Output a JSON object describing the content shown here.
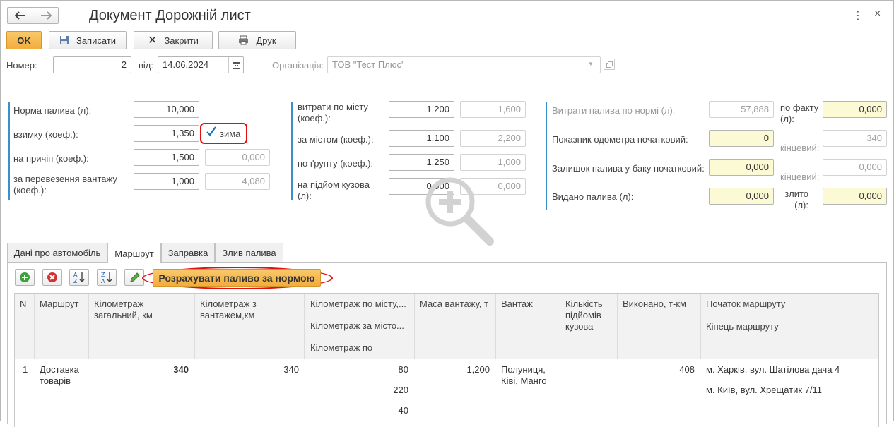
{
  "window": {
    "title": "Документ Дорожній лист"
  },
  "toolbar": {
    "ok": "OK",
    "save": "Записати",
    "close": "Закрити",
    "print": "Друк"
  },
  "header": {
    "number_label": "Номер:",
    "number": "2",
    "date_label": "від:",
    "date": "14.06.2024",
    "org_label": "Організація:",
    "org": "ТОВ \"Тест Плюс\""
  },
  "col1": {
    "norm_label": "Норма палива (л):",
    "norm": "10,000",
    "winter_label": "взимку (коеф.):",
    "winter": "1,350",
    "winter_check_label": "зима",
    "trailer_label": "на причіп (коеф.):",
    "trailer": "1,500",
    "trailer_calc": "0,000",
    "cargo_label": "за перевезення вантажу (коеф.):",
    "cargo": "1,000",
    "cargo_calc": "4,080"
  },
  "col2": {
    "city_label": "витрати по місту (коеф.):",
    "city": "1,200",
    "city_calc": "1,600",
    "outcity_label": "за містом (коеф.):",
    "outcity": "1,100",
    "outcity_calc": "2,200",
    "ground_label": "по ґрунту (коеф.):",
    "ground": "1,250",
    "ground_calc": "1,000",
    "lift_label": "на підйом кузова (л):",
    "lift": "0,000",
    "lift_calc": "0,000"
  },
  "col3": {
    "norm_consumption_label": "Витрати палива по нормі (л):",
    "norm_consumption": "57,888",
    "fact_label": "по факту (л):",
    "fact": "0,000",
    "odo_start_label": "Показник одометра початковий:",
    "odo_start": "0",
    "odo_end_label": "кінцевий:",
    "odo_end": "340",
    "tank_start_label": "Залишок палива у баку початковий:",
    "tank_start": "0,000",
    "tank_end_label": "кінцевий:",
    "tank_end": "0,000",
    "issued_label": "Видано палива (л):",
    "issued": "0,000",
    "drained_label": "злито (л):",
    "drained": "0,000"
  },
  "tabs": [
    "Дані про автомобіль",
    "Маршрут",
    "Заправка",
    "Злив палива"
  ],
  "route_toolbar": {
    "calc_button": "Розрахувати паливо за нормою"
  },
  "table": {
    "headers": {
      "n": "N",
      "route": "Маршрут",
      "km_total": "Кілометраж загальний, км",
      "km_cargo": "Кілометраж з вантажем,км",
      "km_city": "Кілометраж по місту,...",
      "km_outcity": "Кілометраж за місто...",
      "km_ground": "Кілометраж по",
      "mass": "Маса вантажу, т",
      "cargo": "Вантаж",
      "lifts": "Кількість підйомів кузова",
      "done": "Виконано, т-км",
      "start": "Початок маршруту",
      "end": "Кінець маршруту"
    },
    "rows": [
      {
        "n": "1",
        "route": "Доставка товарів",
        "km_total": "340",
        "km_cargo": "340",
        "km_city": "80",
        "km_outcity": "220",
        "km_ground": "40",
        "mass": "1,200",
        "cargo": "Полуниця, Ківі, Манго",
        "lifts": "",
        "done": "408",
        "start": "м. Харків, вул. Шатілова дача 4",
        "end": "м. Київ, вул. Хрещатик 7/11"
      }
    ]
  },
  "colors": {
    "accent": "#3d8fc8",
    "highlight": "#e01010",
    "ok_button": "#f5b54a",
    "yellow_field": "#fcf9d5"
  }
}
